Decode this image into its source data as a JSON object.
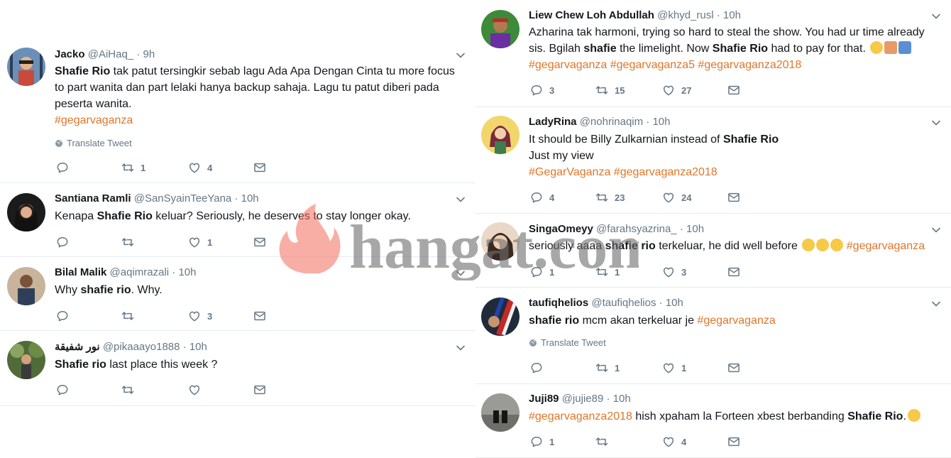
{
  "colors": {
    "hashtag": "#e0762a",
    "muted": "#657786",
    "text": "#14171a",
    "divider": "#e6ecf0"
  },
  "watermark": {
    "text": "hangat.com"
  },
  "left_tweets": [
    {
      "name": "Jacko",
      "handle": "@AiHaq_",
      "time": "9h",
      "body_parts": [
        "Shafie Rio",
        " tak patut tersingkir sebab lagu Ada Apa Dengan Cinta tu more focus to part wanita dan part lelaki hanya backup sahaja. Lagu tu patut diberi pada peserta wanita.",
        "#gegarvaganza"
      ],
      "translate": "Translate Tweet",
      "replies": "",
      "retweets": "1",
      "likes": "4"
    },
    {
      "name": "Santiana Ramli",
      "handle": "@SanSyainTeeYana",
      "time": "10h",
      "body_parts": [
        "Kenapa ",
        "Shafie Rio",
        " keluar? Seriously, he deserves to stay longer okay."
      ],
      "replies": "",
      "retweets": "",
      "likes": "1"
    },
    {
      "name": "Bilal Malik",
      "handle": "@aqimrazali",
      "time": "10h",
      "body_parts": [
        "Why ",
        "shafie rio",
        ". Why."
      ],
      "replies": "",
      "retweets": "",
      "likes": "3"
    },
    {
      "name": "نور شفيقة",
      "handle": "@pikaaayo1888",
      "time": "10h",
      "body_parts": [
        "Shafie rio",
        " last place this week ?"
      ],
      "replies": "",
      "retweets": "",
      "likes": ""
    }
  ],
  "right_tweets": [
    {
      "name": "Liew Chew Loh Abdullah",
      "handle": "@khyd_rusl",
      "time": "10h",
      "body_parts": [
        "Azharina tak harmoni, trying so hard to steal the show. You had ur time already sis. Bgilah ",
        "shafie",
        " the limelight. Now ",
        "Shafie Rio",
        " had to pay for that.",
        "#gegarvaganza #gegarvaganza5 #gegarvaganza2018"
      ],
      "replies": "3",
      "retweets": "15",
      "likes": "27"
    },
    {
      "name": "LadyRina",
      "handle": "@nohrinaqim",
      "time": "10h",
      "body_parts": [
        "It should be Billy Zulkarnian instead of ",
        "Shafie Rio",
        "Just my view",
        "#GegarVaganza #gegarvaganza2018"
      ],
      "replies": "4",
      "retweets": "23",
      "likes": "24"
    },
    {
      "name": "SingaOmeyy",
      "handle": "@farahsyazrina_",
      "time": "10h",
      "body_parts": [
        "seriously aaaa ",
        "shafie rio",
        " terkeluar, he did well before ",
        "#gegarvaganza"
      ],
      "replies": "1",
      "retweets": "1",
      "likes": "3"
    },
    {
      "name": "taufiqhelios",
      "handle": "@taufiqhelios",
      "time": "10h",
      "body_parts": [
        "shafie rio",
        " mcm akan terkeluar je ",
        "#gegarvaganza"
      ],
      "translate": "Translate Tweet",
      "replies": "",
      "retweets": "1",
      "likes": "1"
    },
    {
      "name": "Juji89",
      "handle": "@jujie89",
      "time": "10h",
      "body_parts": [
        "#gegarvaganza2018",
        " hish xpaham la Forteen xbest berbanding ",
        "Shafie Rio",
        "."
      ],
      "replies": "1",
      "retweets": "",
      "likes": "4"
    }
  ]
}
